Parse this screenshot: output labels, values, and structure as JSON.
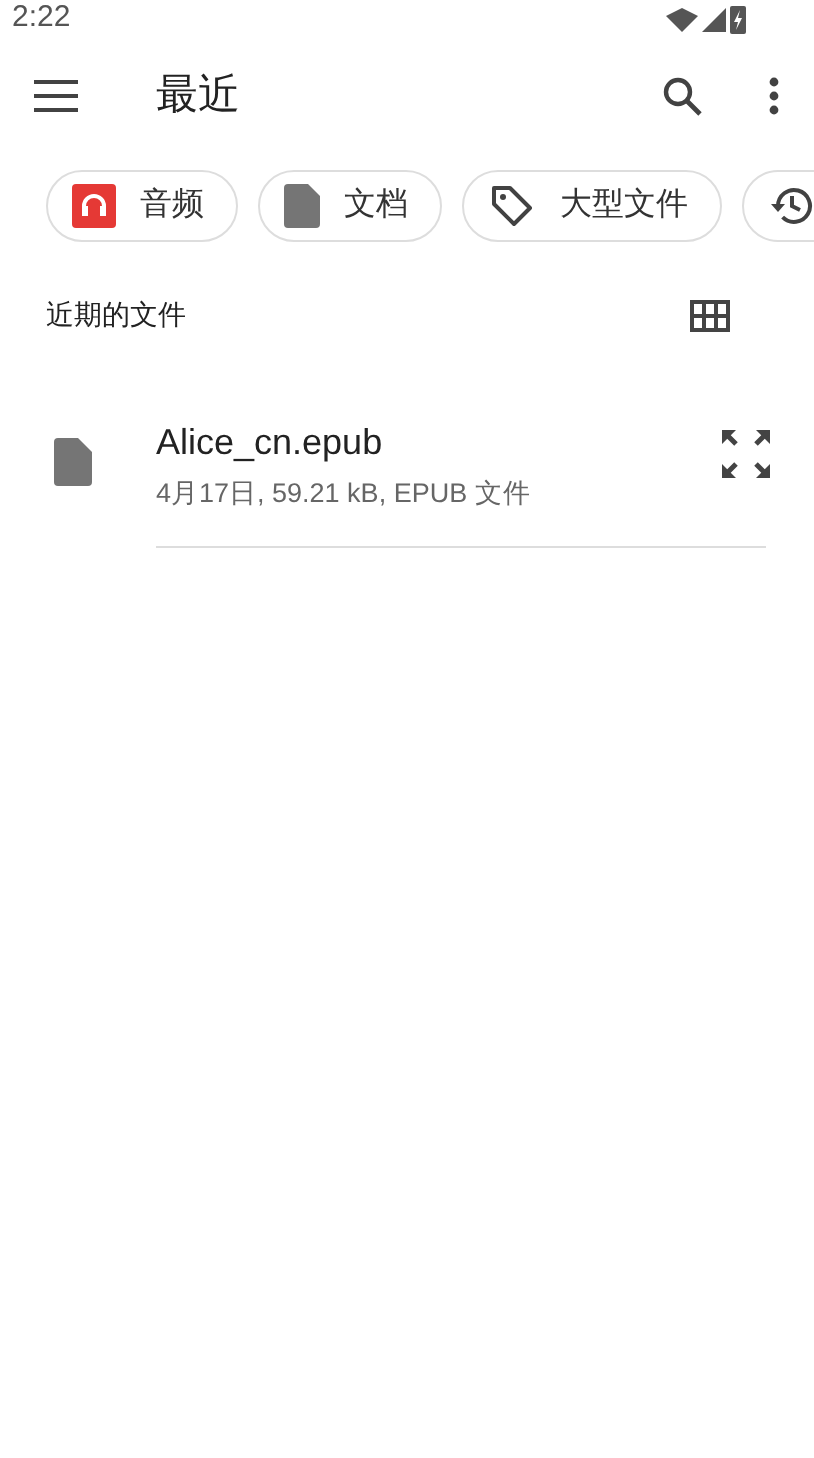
{
  "status_bar": {
    "time": "2:22"
  },
  "app_bar": {
    "title": "最近"
  },
  "chips": [
    {
      "kind": "audio",
      "label": "音频"
    },
    {
      "kind": "document",
      "label": "文档"
    },
    {
      "kind": "large",
      "label": "大型文件"
    },
    {
      "kind": "recent"
    }
  ],
  "section": {
    "title": "近期的文件"
  },
  "files": [
    {
      "name": "Alice_cn.epub",
      "details": "4月17日, 59.21 kB, EPUB 文件"
    }
  ]
}
